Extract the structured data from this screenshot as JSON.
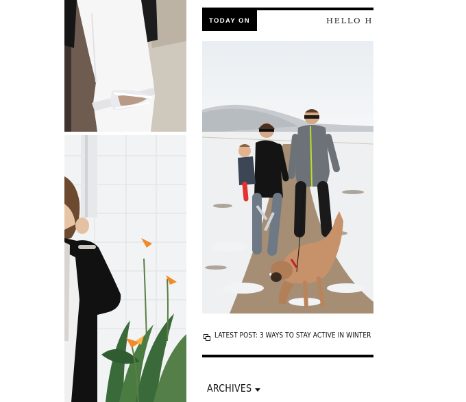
{
  "today_on": {
    "badge_label": "TODAY ON",
    "hello_text": "HELLO HISTORY"
  },
  "latest_post": {
    "icon": "duplicate-icon",
    "text": "LATEST POST: 3 WAYS TO STAY ACTIVE IN WINTER"
  },
  "archives": {
    "label": "ARCHIVES",
    "icon": "caret-down-icon"
  },
  "photos": [
    {
      "name": "ripped-white-jeans-photo"
    },
    {
      "name": "black-cardigan-bird-of-paradise-photo"
    },
    {
      "name": "family-walking-dog-snow-photo"
    }
  ],
  "colors": {
    "text": "#111111",
    "badge_bg": "#000000",
    "badge_text": "#ffffff",
    "rule": "#000000"
  }
}
